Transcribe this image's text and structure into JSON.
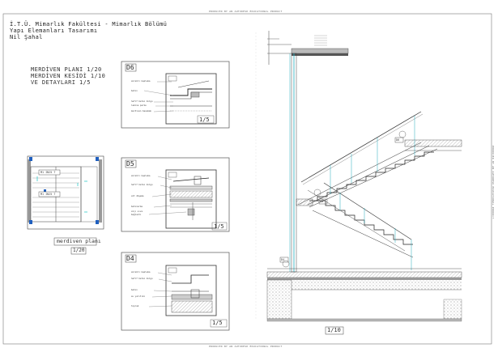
{
  "header": {
    "line1": "İ.T.Ü. Mimarlık Fakültesi - Mimarlık Bölümü",
    "line2": "Yapı Elemanları Tasarımı",
    "line3": "Nil Şahal"
  },
  "plan_title": {
    "line1": "MERDİVEN PLANI 1/20",
    "line2": "MERDİVEN KESİDİ 1/10",
    "line3": "VE DETAYLARI 1/5"
  },
  "edu_stamp": "PRODUCED BY AN AUTODESK EDUCATIONAL PRODUCT",
  "details": {
    "d6": {
      "label": "D6",
      "scale": "1/5",
      "notes": [
        "sürekli kaplama",
        "beton",
        "hafif beton dolgu",
        "lamine parke",
        "merdiven basamak"
      ]
    },
    "d5": {
      "label": "D5",
      "scale": "1/5",
      "notes": [
        "sürekli kaplama",
        "hafif beton dolgu",
        "alt döşeme",
        "betonarme",
        "alçı sıva",
        "bağlantı"
      ]
    },
    "d4": {
      "label": "D4",
      "scale": "1/5",
      "notes": [
        "sürekli kaplama",
        "hafif beton dolgu",
        "beton",
        "su yalıtımı",
        "toprak"
      ]
    }
  },
  "stair_plan": {
    "tag1": "M1 IN25 T",
    "tag2": "M1 IN25 T",
    "caption": "merdiven planı",
    "scale": "1/20"
  },
  "section": {
    "scale": "1/10",
    "tags": [
      "D6",
      "D5",
      "D4"
    ]
  }
}
